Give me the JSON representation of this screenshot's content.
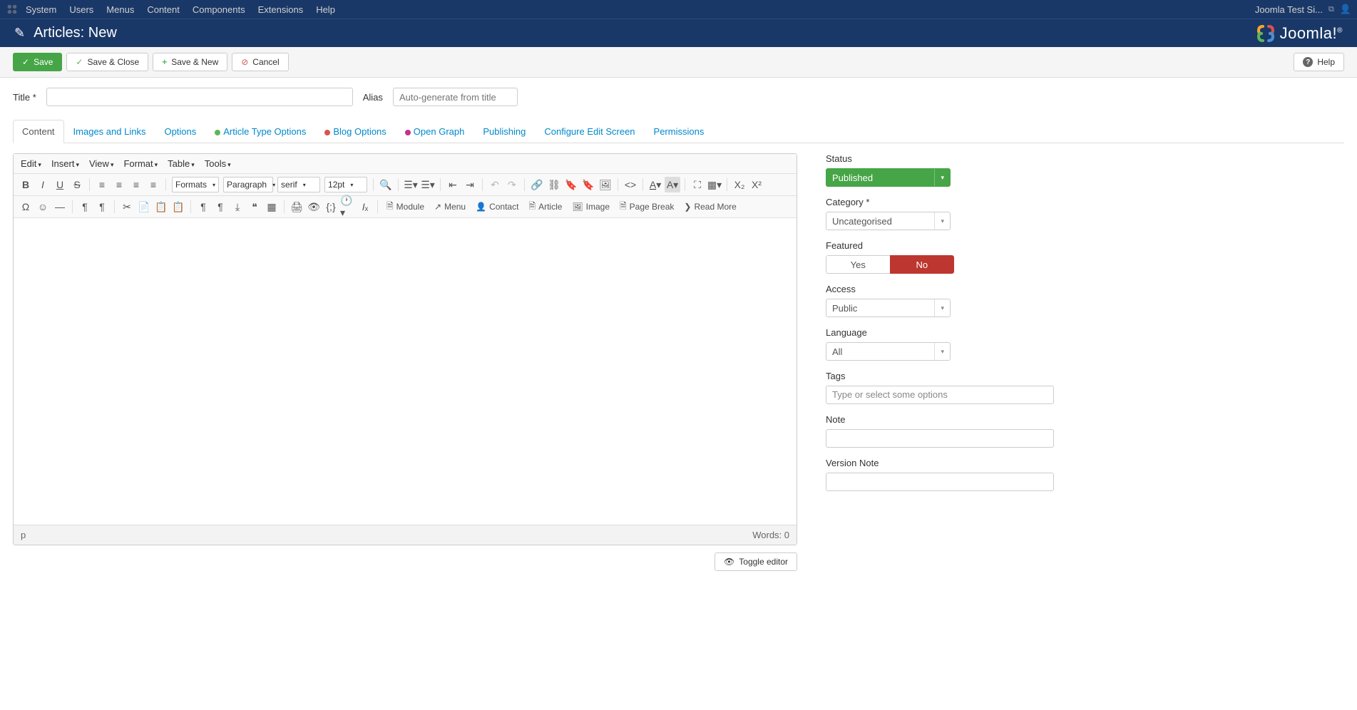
{
  "topnav": {
    "site_label": "Joomla Test Si...",
    "items": [
      "System",
      "Users",
      "Menus",
      "Content",
      "Components",
      "Extensions",
      "Help"
    ]
  },
  "header": {
    "title": "Articles: New",
    "logo_text": "Joomla!"
  },
  "toolbar": {
    "save": "Save",
    "save_close": "Save & Close",
    "save_new": "Save & New",
    "cancel": "Cancel",
    "help": "Help"
  },
  "form": {
    "title_label": "Title *",
    "alias_label": "Alias",
    "alias_placeholder": "Auto-generate from title"
  },
  "tabs": {
    "content": "Content",
    "images": "Images and Links",
    "options": "Options",
    "article_type": "Article Type Options",
    "blog": "Blog Options",
    "opengraph": "Open Graph",
    "publishing": "Publishing",
    "configure": "Configure Edit Screen",
    "permissions": "Permissions"
  },
  "editor": {
    "menus": {
      "edit": "Edit",
      "insert": "Insert",
      "view": "View",
      "format": "Format",
      "table": "Table",
      "tools": "Tools"
    },
    "sel_formats": "Formats",
    "sel_paragraph": "Paragraph",
    "sel_font": "serif",
    "sel_size": "12pt",
    "btn_module": "Module",
    "btn_menu": "Menu",
    "btn_contact": "Contact",
    "btn_article": "Article",
    "btn_image": "Image",
    "btn_pagebreak": "Page Break",
    "btn_readmore": "Read More",
    "status_path": "p",
    "status_words": "Words: 0",
    "toggle": "Toggle editor"
  },
  "sidebar": {
    "status": {
      "label": "Status",
      "value": "Published"
    },
    "category": {
      "label": "Category *",
      "value": "Uncategorised"
    },
    "featured": {
      "label": "Featured",
      "yes": "Yes",
      "no": "No"
    },
    "access": {
      "label": "Access",
      "value": "Public"
    },
    "language": {
      "label": "Language",
      "value": "All"
    },
    "tags": {
      "label": "Tags",
      "placeholder": "Type or select some options"
    },
    "note": {
      "label": "Note"
    },
    "version_note": {
      "label": "Version Note"
    }
  }
}
